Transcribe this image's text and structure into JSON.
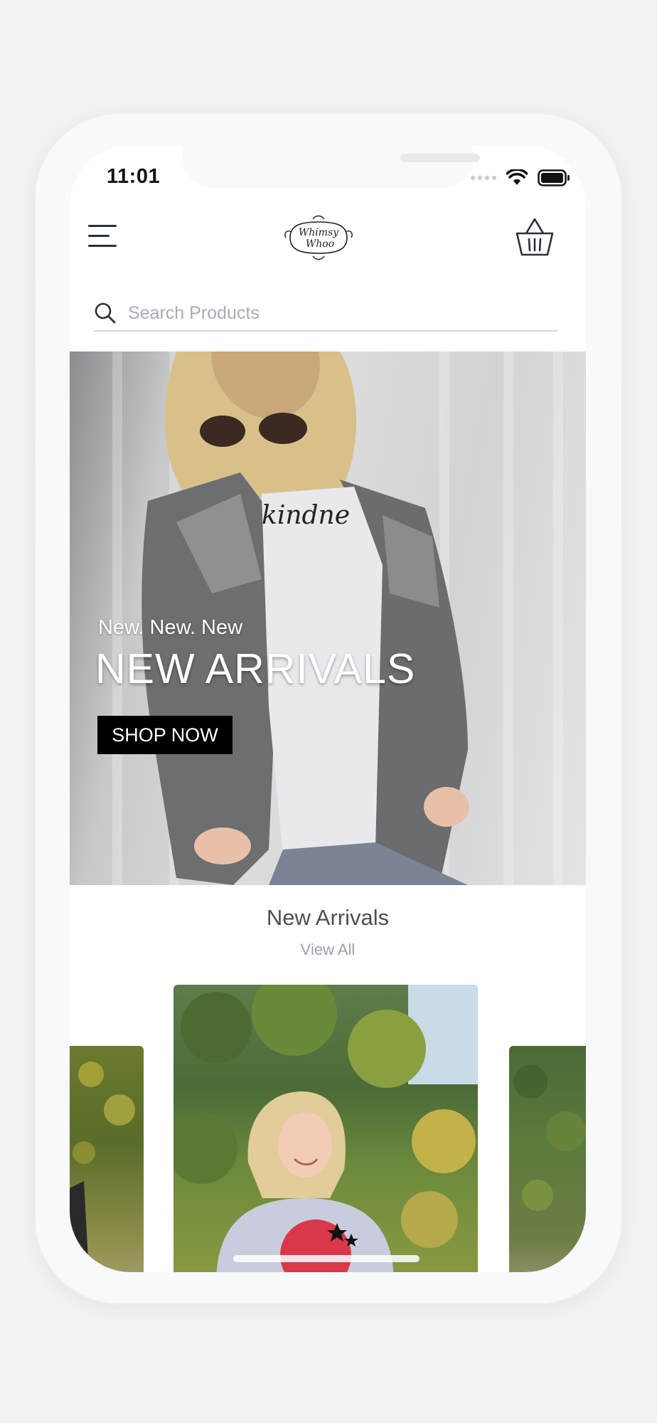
{
  "status_bar": {
    "time": "11:01"
  },
  "header": {
    "menu_icon": "hamburger-menu-icon",
    "logo_text_line1": "Whimsy",
    "logo_text_line2": "Whoo",
    "cart_icon": "shopping-basket-icon"
  },
  "search": {
    "placeholder": "Search Products",
    "value": ""
  },
  "hero": {
    "subtitle": "New. New. New",
    "title": "NEW ARRIVALS",
    "shirt_text": "kindne",
    "cta_label": "SHOP NOW"
  },
  "new_arrivals": {
    "title": "New Arrivals",
    "view_all_label": "View All"
  },
  "colors": {
    "accent": "#000000",
    "muted_text": "#9aa0b0",
    "title_text": "#4d4f55",
    "background": "#ffffff"
  }
}
